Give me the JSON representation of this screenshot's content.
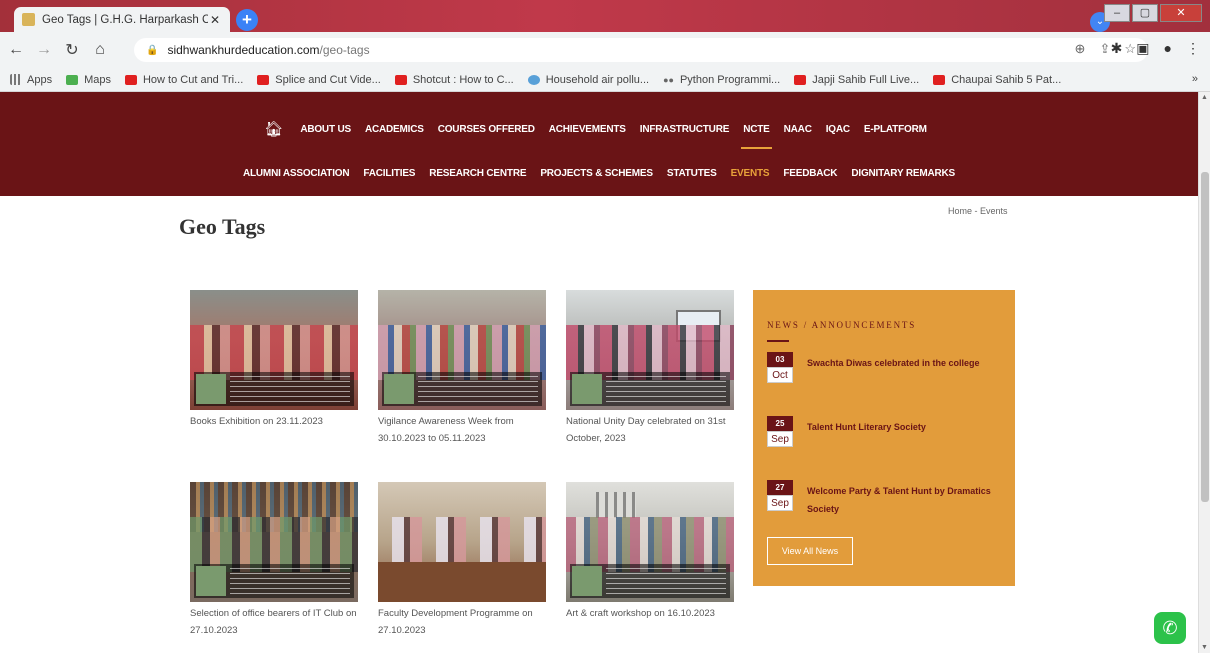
{
  "browser": {
    "tab_title": "Geo Tags | G.H.G. Harparkash Co",
    "tab_close": "✕",
    "new_tab": "+",
    "url_host": "sidhwankhurdeducation.com",
    "url_path": "/geo-tags",
    "window_title": "",
    "bookmarks": [
      {
        "label": "Apps",
        "icon": "apps-grid-icon"
      },
      {
        "label": "Maps",
        "icon": "maps-icon"
      },
      {
        "label": "How to Cut and Tri...",
        "icon": "youtube-icon"
      },
      {
        "label": "Splice and Cut Vide...",
        "icon": "youtube-icon"
      },
      {
        "label": "Shotcut : How to C...",
        "icon": "youtube-icon"
      },
      {
        "label": "Household air pollu...",
        "icon": "un-icon"
      },
      {
        "label": "Python Programmi...",
        "icon": "python-icon"
      },
      {
        "label": "Japji Sahib Full Live...",
        "icon": "youtube-icon"
      },
      {
        "label": "Chaupai Sahib 5 Pat...",
        "icon": "youtube-icon"
      }
    ],
    "bookmarks_more": "»"
  },
  "nav": {
    "row1": [
      {
        "label": "ABOUT US"
      },
      {
        "label": "ACADEMICS"
      },
      {
        "label": "COURSES OFFERED"
      },
      {
        "label": "ACHIEVEMENTS"
      },
      {
        "label": "INFRASTRUCTURE"
      },
      {
        "label": "NCTE"
      },
      {
        "label": "NAAC"
      },
      {
        "label": "IQAC"
      },
      {
        "label": "E-PLATFORM"
      }
    ],
    "row2": [
      {
        "label": "ALUMNI ASSOCIATION"
      },
      {
        "label": "FACILITIES"
      },
      {
        "label": "RESEARCH CENTRE"
      },
      {
        "label": "PROJECTS & SCHEMES"
      },
      {
        "label": "STATUTES"
      },
      {
        "label": "EVENTS"
      },
      {
        "label": "FEEDBACK"
      },
      {
        "label": "DIGNITARY REMARKS"
      }
    ],
    "active_item": "EVENTS",
    "accent_color": "#e8a23a",
    "bg_color": "#6a1416"
  },
  "page": {
    "title": "Geo Tags",
    "breadcrumb_home": "Home",
    "breadcrumb_sep": "-",
    "breadcrumb_current": "Events"
  },
  "gallery": [
    {
      "caption": "Books Exhibition on 23.11.2023"
    },
    {
      "caption": "Vigilance Awareness Week from 30.10.2023 to 05.11.2023"
    },
    {
      "caption": "National Unity Day celebrated on 31st October, 2023"
    },
    {
      "caption": "Selection of office bearers of IT Club on 27.10.2023"
    },
    {
      "caption": "Faculty Development Programme on 27.10.2023"
    },
    {
      "caption": "Art & craft workshop on 16.10.2023"
    }
  ],
  "news": {
    "heading": "NEWS / ANNOUNCEMENTS",
    "items": [
      {
        "day": "03",
        "month": "Oct",
        "text": "Swachta Diwas celebrated in the college"
      },
      {
        "day": "25",
        "month": "Sep",
        "text": "Talent Hunt Literary Society"
      },
      {
        "day": "27",
        "month": "Sep",
        "text": "Welcome Party & Talent Hunt by Dramatics Society"
      }
    ],
    "view_all": "View All News",
    "box_color": "#e29c3b"
  }
}
